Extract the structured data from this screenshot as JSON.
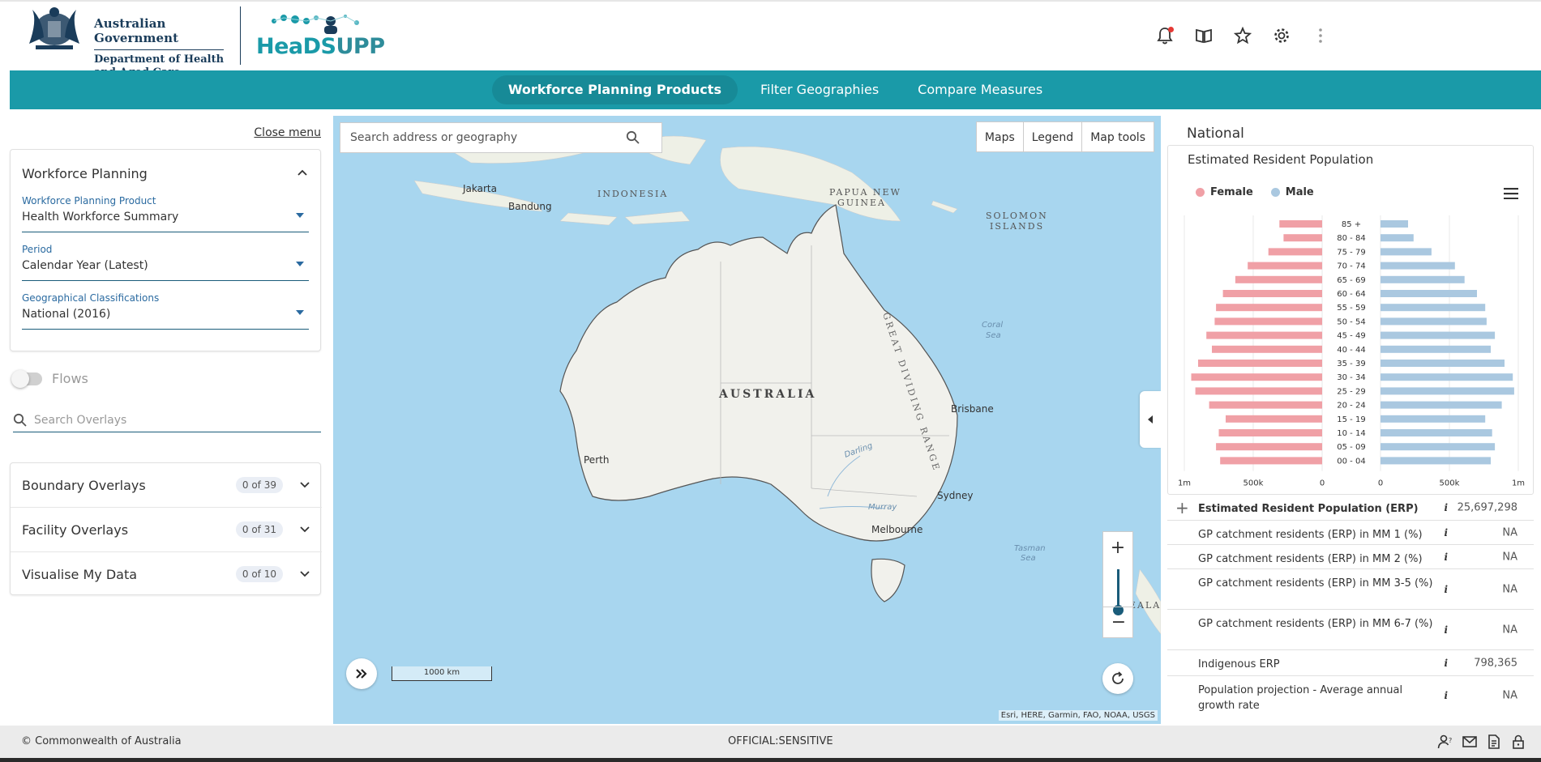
{
  "header": {
    "gov_line1": "Australian Government",
    "gov_line2": "Department of Health",
    "gov_line3": "and Aged Care",
    "app_name_a": "HeaDS",
    "app_name_b": "UPP",
    "icons": [
      "bell-icon",
      "book-icon",
      "star-icon",
      "gear-icon",
      "more-vert-icon"
    ]
  },
  "nav": {
    "tabs": [
      {
        "label": "Workforce Planning Products",
        "active": true
      },
      {
        "label": "Filter Geographies",
        "active": false
      },
      {
        "label": "Compare Measures",
        "active": false
      }
    ]
  },
  "left": {
    "close_menu": "Close menu",
    "card_title": "Workforce Planning",
    "fields": [
      {
        "label": "Workforce Planning Product",
        "value": "Health Workforce Summary"
      },
      {
        "label": "Period",
        "value": "Calendar Year (Latest)"
      },
      {
        "label": "Geographical Classifications",
        "value": "National (2016)"
      }
    ],
    "flows_label": "Flows",
    "overlay_search_placeholder": "Search Overlays",
    "overlays": [
      {
        "name": "Boundary Overlays",
        "count": "0 of 39"
      },
      {
        "name": "Facility Overlays",
        "count": "0 of 31"
      },
      {
        "name": "Visualise My Data",
        "count": "0 of 10"
      }
    ]
  },
  "map": {
    "search_placeholder": "Search address or geography",
    "buttons": [
      "Maps",
      "Legend",
      "Map tools"
    ],
    "labels": {
      "jakarta": "Jakarta",
      "bandung": "Bandung",
      "indonesia": "INDONESIA",
      "png1": "PAPUA NEW",
      "png2": "GUINEA",
      "solomon1": "SOLOMON",
      "solomon2": "ISLANDS",
      "coral1": "Coral",
      "coral2": "Sea",
      "australia": "AUSTRALIA",
      "range": "GREAT DIVIDING RANGE",
      "brisbane": "Brisbane",
      "perth": "Perth",
      "darling": "Darling",
      "murray": "Murray",
      "sydney": "Sydney",
      "melbourne": "Melbourne",
      "tasman1": "Tasman",
      "tasman2": "Sea",
      "zealand": "EALA"
    },
    "scale": "1000 km",
    "attribution": "Esri, HERE, Garmin, FAO, NOAA, USGS"
  },
  "right": {
    "title": "National",
    "chart_title": "Estimated Resident Population",
    "measures": [
      {
        "name": "Estimated Resident Population (ERP)",
        "value": "25,697,298",
        "head": true
      },
      {
        "name": "GP catchment residents (ERP) in MM 1 (%)",
        "value": "NA"
      },
      {
        "name": "GP catchment residents (ERP) in MM 2 (%)",
        "value": "NA"
      },
      {
        "name": "GP catchment residents (ERP) in MM 3-5 (%)",
        "value": "NA"
      },
      {
        "name": "GP catchment residents (ERP) in MM 6-7 (%)",
        "value": "NA"
      },
      {
        "name": "Indigenous ERP",
        "value": "798,365"
      },
      {
        "name": "Population projection - Average annual growth rate",
        "value": "NA"
      }
    ],
    "info_glyph": "i"
  },
  "chart_data": {
    "type": "bar",
    "orientation": "horizontal-pyramid",
    "categories": [
      "85 +",
      "80 - 84",
      "75 - 79",
      "70 - 74",
      "65 - 69",
      "60 - 64",
      "55 - 59",
      "50 - 54",
      "45 - 49",
      "40 - 44",
      "35 - 39",
      "30 - 34",
      "25 - 29",
      "20 - 24",
      "15 - 19",
      "10 - 14",
      "05 - 09",
      "00 - 04"
    ],
    "series": [
      {
        "name": "Female",
        "color": "#f0a0a6",
        "values": [
          310000,
          280000,
          390000,
          540000,
          630000,
          720000,
          770000,
          780000,
          840000,
          800000,
          900000,
          950000,
          920000,
          820000,
          700000,
          750000,
          770000,
          740000
        ]
      },
      {
        "name": "Male",
        "color": "#aac8e0",
        "values": [
          200000,
          240000,
          370000,
          540000,
          610000,
          700000,
          760000,
          770000,
          830000,
          800000,
          900000,
          960000,
          970000,
          880000,
          760000,
          810000,
          830000,
          800000
        ]
      }
    ],
    "xticks_left": [
      "1m",
      "500k",
      "0"
    ],
    "xticks_right": [
      "0",
      "500k",
      "1m"
    ],
    "xlim": [
      0,
      1000000
    ],
    "legend_position": "top-left",
    "grid": true
  }
}
